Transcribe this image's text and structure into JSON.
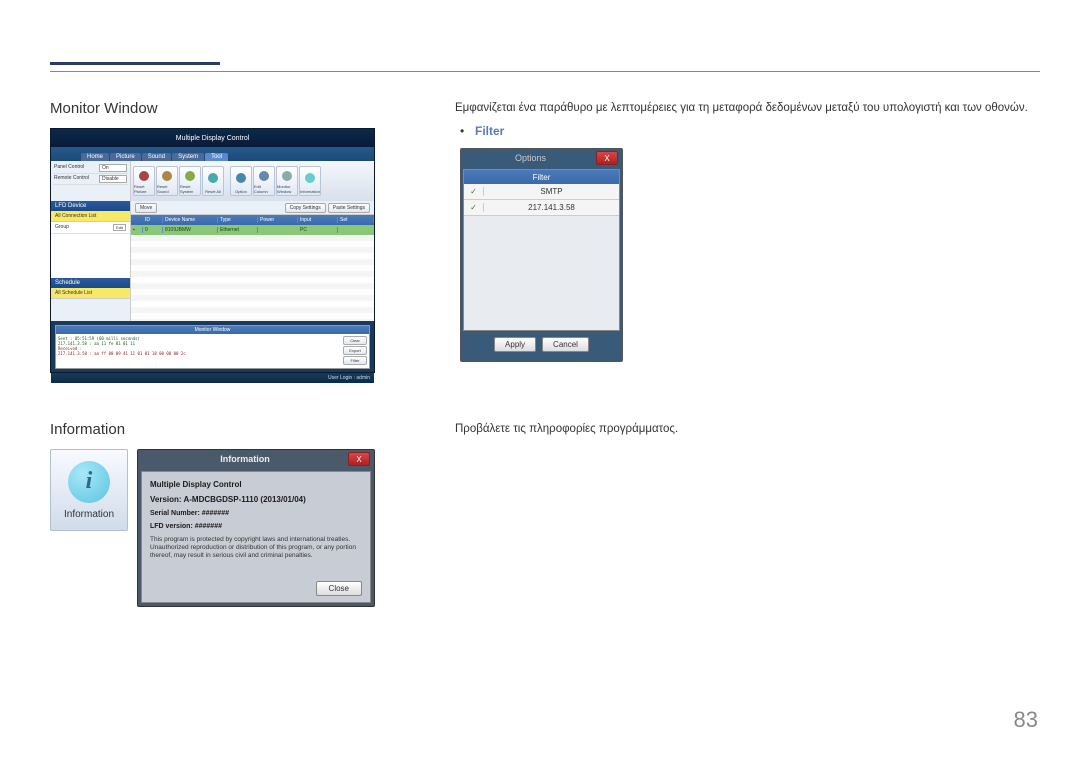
{
  "page_number": "83",
  "section1": {
    "title": "Monitor Window",
    "description": "Εμφανίζεται ένα παράθυρο με λεπτομέρειες για τη μεταφορά δεδομένων μεταξύ του υπολογιστή και των οθονών.",
    "filter_label": "Filter",
    "bullet": "•"
  },
  "section2": {
    "title": "Information",
    "description": "Προβάλετε τις πληροφορίες προγράμματος."
  },
  "mdc": {
    "app_title": "Multiple Display Control",
    "tabs": [
      "Home",
      "Picture",
      "Sound",
      "System",
      "Tool"
    ],
    "side_controls": {
      "panel": {
        "label": "Panel Control",
        "value": "On"
      },
      "remote": {
        "label": "Remote Control",
        "value": "Disable"
      }
    },
    "toolbar": [
      "Reset Picture",
      "Reset Sound",
      "Reset System",
      "Reset All",
      "Option",
      "Edit Column",
      "Monitor Window",
      "Information"
    ],
    "copy_settings": {
      "move": "Move",
      "copy": "Copy Settings",
      "paste": "Paste Settings"
    },
    "sidebar": {
      "lfd_header": "LFD Device",
      "all_conn": "All Connection List",
      "group": "Group",
      "edit": "Edit",
      "schedule_header": "Schedule",
      "all_schedule": "All Schedule List"
    },
    "table": {
      "columns": [
        "",
        "ID",
        "Device Name",
        "Type",
        "Power",
        "Input",
        "Set"
      ],
      "row1": {
        "id": "0",
        "name": "8109JBMW",
        "type": "Ethernet",
        "input": "PC"
      }
    },
    "monitor_panel": {
      "title": "Monitor Window",
      "sent_label": "Sent : 05:51:59 (60 milli seconds)",
      "sent_data": "217.141.3.58 : aa 11 fe 01 01 11",
      "recv_label": "Received :",
      "recv_data": "217.141.3.58 : aa ff 00 09 41 11 01 01 18 00 00 00 2c",
      "buttons": {
        "clear": "Clear",
        "export": "Export",
        "filter": "Filter"
      }
    },
    "status": "User Login : admin"
  },
  "filter_dialog": {
    "title": "Options",
    "close": "X",
    "col_header": "Filter",
    "rows": [
      "SMTP",
      "217.141.3.58"
    ],
    "check": "✓",
    "apply": "Apply",
    "cancel": "Cancel"
  },
  "info_icon": {
    "glyph": "i",
    "label": "Information"
  },
  "info_dialog": {
    "title": "Information",
    "close": "X",
    "product": "Multiple Display Control",
    "version": "Version: A-MDCBGDSP-1110 (2013/01/04)",
    "serial": "Serial Number: #######",
    "lfd": "LFD version: #######",
    "legal": "This program is protected by copyright laws and international treaties. Unauthorized reproduction or distribution of this program, or any portion thereof, may result in serious civil and criminal penalties.",
    "close_btn": "Close"
  }
}
